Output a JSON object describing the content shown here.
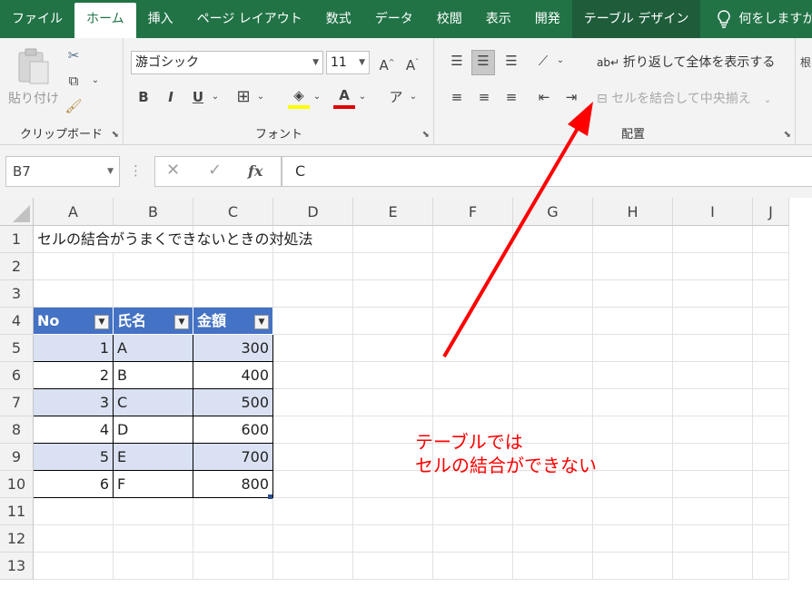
{
  "tabs": [
    "ファイル",
    "ホーム",
    "挿入",
    "ページ レイアウト",
    "数式",
    "データ",
    "校閲",
    "表示",
    "開発",
    "テーブル デザイン"
  ],
  "tell_me": "何をしますか",
  "ribbon": {
    "paste_label": "貼り付け",
    "clipboard_label": "クリップボード",
    "font_label": "フォント",
    "font_name": "游ゴシック",
    "font_size": "11",
    "align_label": "配置",
    "wrap_text": "折り返して全体を表示する",
    "merge_center": "セルを結合して中央揃え"
  },
  "formula": {
    "namebox": "B7",
    "fx": "fx",
    "content": "C"
  },
  "columns": [
    "A",
    "B",
    "C",
    "D",
    "E",
    "F",
    "G",
    "H",
    "I",
    "J"
  ],
  "rows": [
    "1",
    "2",
    "3",
    "4",
    "5",
    "6",
    "7",
    "8",
    "9",
    "10",
    "11",
    "12",
    "13"
  ],
  "title_cell": "セルの結合がうまくできないときの対処法",
  "table": {
    "headers": [
      "No",
      "氏名",
      "金額"
    ],
    "rows": [
      [
        "1",
        "A",
        "300"
      ],
      [
        "2",
        "B",
        "400"
      ],
      [
        "3",
        "C",
        "500"
      ],
      [
        "4",
        "D",
        "600"
      ],
      [
        "5",
        "E",
        "700"
      ],
      [
        "6",
        "F",
        "800"
      ]
    ]
  },
  "annotation": {
    "line1": "テーブルでは",
    "line2": "セルの結合ができない"
  },
  "colors": {
    "excel_green": "#217346",
    "table_header": "#4472c4",
    "band": "#d9e1f2",
    "arrow": "#ff0000"
  }
}
